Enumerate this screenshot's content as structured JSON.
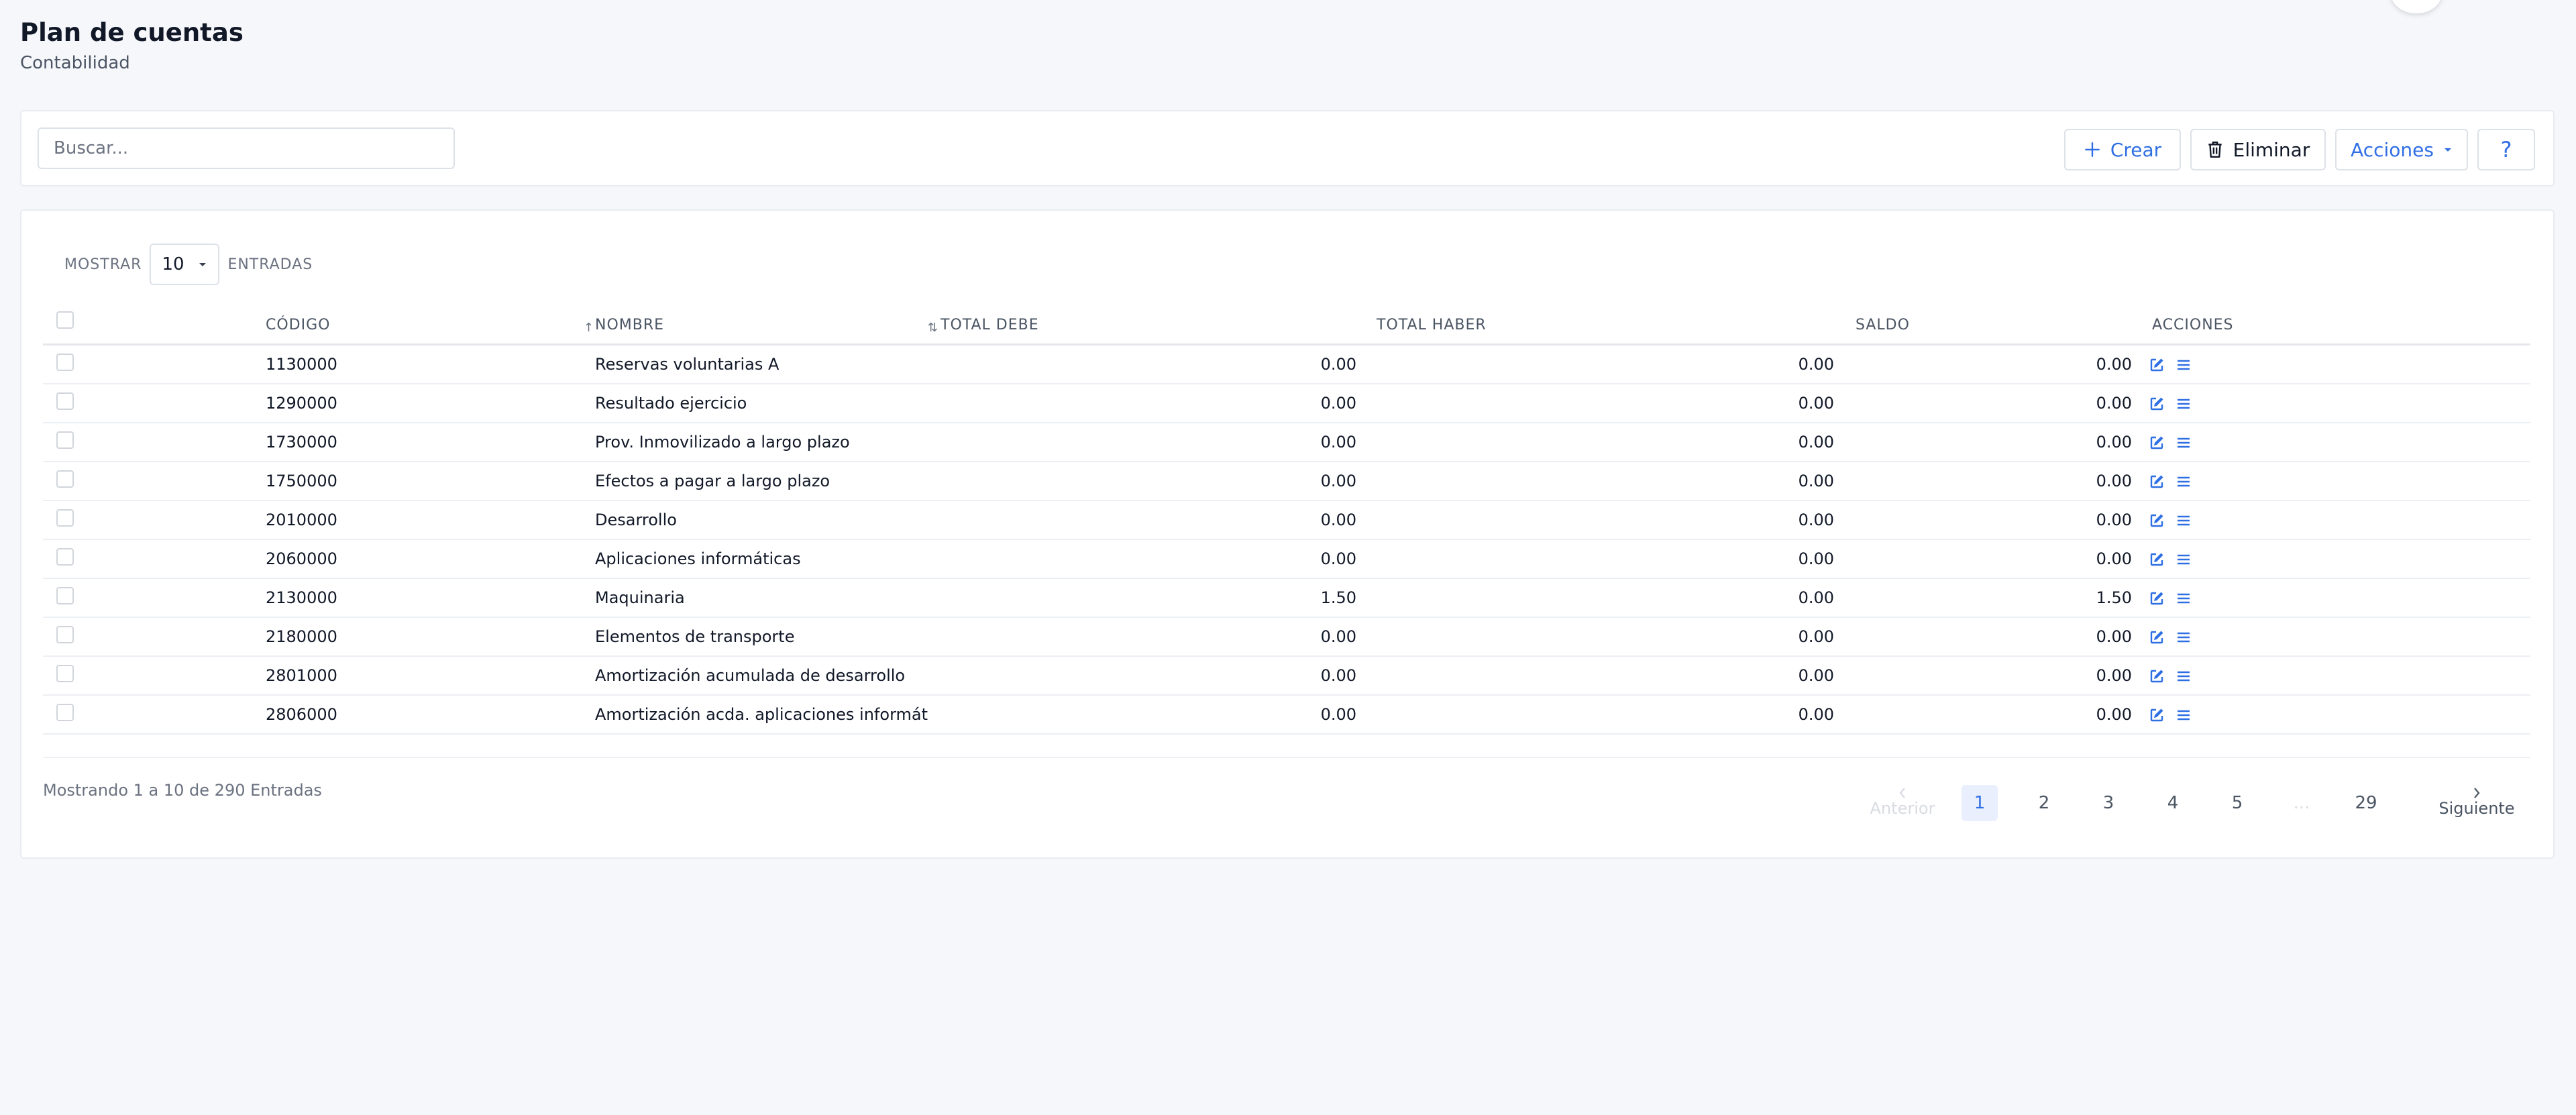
{
  "page": {
    "title": "Plan de cuentas",
    "subtitle": "Contabilidad"
  },
  "toolbar": {
    "search_placeholder": "Buscar...",
    "create_label": "Crear",
    "delete_label": "Eliminar",
    "actions_label": "Acciones",
    "help_label": "?"
  },
  "table": {
    "length": {
      "prefix": "MOSTRAR",
      "value": "10",
      "suffix": "ENTRADAS"
    },
    "columns": {
      "codigo": "CÓDIGO",
      "nombre": "NOMBRE",
      "total_debe": "TOTAL DEBE",
      "total_haber": "TOTAL HABER",
      "saldo": "SALDO",
      "acciones": "ACCIONES"
    },
    "rows": [
      {
        "codigo": "1130000",
        "nombre": "Reservas voluntarias A",
        "debe": "0.00",
        "haber": "0.00",
        "saldo": "0.00"
      },
      {
        "codigo": "1290000",
        "nombre": "Resultado ejercicio",
        "debe": "0.00",
        "haber": "0.00",
        "saldo": "0.00"
      },
      {
        "codigo": "1730000",
        "nombre": "Prov. Inmovilizado a largo plazo",
        "debe": "0.00",
        "haber": "0.00",
        "saldo": "0.00"
      },
      {
        "codigo": "1750000",
        "nombre": "Efectos a pagar a largo plazo",
        "debe": "0.00",
        "haber": "0.00",
        "saldo": "0.00"
      },
      {
        "codigo": "2010000",
        "nombre": "Desarrollo",
        "debe": "0.00",
        "haber": "0.00",
        "saldo": "0.00"
      },
      {
        "codigo": "2060000",
        "nombre": "Aplicaciones informáticas",
        "debe": "0.00",
        "haber": "0.00",
        "saldo": "0.00"
      },
      {
        "codigo": "2130000",
        "nombre": "Maquinaria",
        "debe": "1.50",
        "haber": "0.00",
        "saldo": "1.50"
      },
      {
        "codigo": "2180000",
        "nombre": "Elementos de transporte",
        "debe": "0.00",
        "haber": "0.00",
        "saldo": "0.00"
      },
      {
        "codigo": "2801000",
        "nombre": "Amortización acumulada de desarrollo",
        "debe": "0.00",
        "haber": "0.00",
        "saldo": "0.00"
      },
      {
        "codigo": "2806000",
        "nombre": "Amortización acda. aplicaciones informát",
        "debe": "0.00",
        "haber": "0.00",
        "saldo": "0.00"
      }
    ],
    "info": "Mostrando 1 a 10 de 290 Entradas"
  },
  "pagination": {
    "prev_label": "Anterior",
    "next_label": "Siguiente",
    "pages": [
      "1",
      "2",
      "3",
      "4",
      "5",
      "...",
      "29"
    ],
    "active": "1"
  },
  "colors": {
    "accent": "#2f6fe4",
    "background": "#f6f7fb",
    "panel": "#ffffff"
  },
  "icons": {
    "create": "plus-icon",
    "delete": "trash-icon",
    "actions": "caret-down-icon",
    "row_edit": "edit-icon",
    "row_menu": "list-icon",
    "prev": "chevron-left-icon",
    "next": "chevron-right-icon"
  }
}
